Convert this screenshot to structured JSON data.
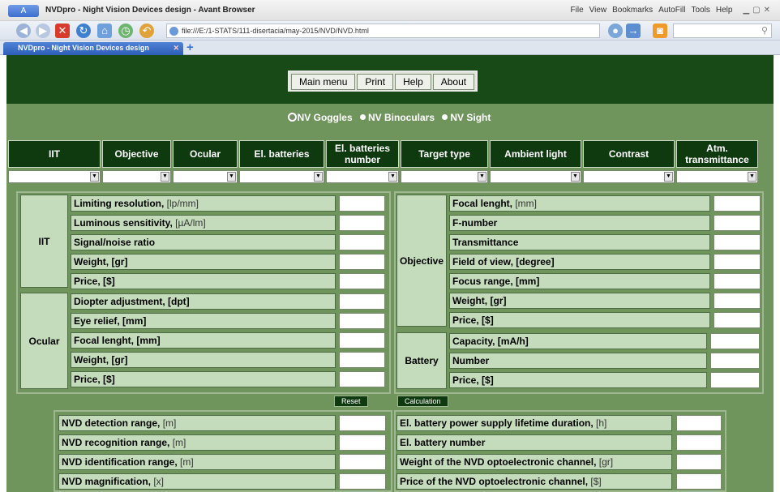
{
  "browser": {
    "logo": "A",
    "window_title": "NVDpro - Night Vision Devices design - Avant Browser",
    "menu": [
      "File",
      "View",
      "Bookmarks",
      "AutoFill",
      "Tools",
      "Help"
    ],
    "address": "file:///E:/1-STATS/111-disertacia/may-2015/NVD/NVD.html",
    "tab_title": "NVDpro - Night Vision Devices design"
  },
  "topmenu": [
    "Main menu",
    "Print",
    "Help",
    "About"
  ],
  "device_types": [
    {
      "label": "NV Goggles",
      "selected": true
    },
    {
      "label": "NV Binoculars",
      "selected": false
    },
    {
      "label": "NV Sight",
      "selected": false
    }
  ],
  "columns": [
    "IIT",
    "Objective",
    "Ocular",
    "El. batteries",
    "El. batteries number",
    "Target type",
    "Ambient light",
    "Contrast",
    "Atm. transmittance"
  ],
  "iit": {
    "title": "IIT",
    "rows": [
      {
        "label": "Limiting resolution, ",
        "unit": "[lp/mm]"
      },
      {
        "label": "Luminous sensitivity, ",
        "unit": "[µA/lm]"
      },
      {
        "label": "Signal/noise ratio",
        "unit": ""
      },
      {
        "label": "Weight, [gr]",
        "unit": ""
      },
      {
        "label": "Price, [$]",
        "unit": ""
      }
    ]
  },
  "ocular": {
    "title": "Ocular",
    "rows": [
      {
        "label": "Diopter adjustment, [dpt]",
        "unit": ""
      },
      {
        "label": "Eye relief, [mm]",
        "unit": ""
      },
      {
        "label": "Focal lenght, [mm]",
        "unit": ""
      },
      {
        "label": "Weight, [gr]",
        "unit": ""
      },
      {
        "label": "Price, [$]",
        "unit": ""
      }
    ]
  },
  "objective": {
    "title": "Objective",
    "rows": [
      {
        "label": "Focal lenght, ",
        "unit": "[mm]"
      },
      {
        "label": "F-number",
        "unit": ""
      },
      {
        "label": "Transmittance",
        "unit": ""
      },
      {
        "label": "Field of view, [degree]",
        "unit": ""
      },
      {
        "label": "Focus range, [mm]",
        "unit": ""
      },
      {
        "label": "Weight, [gr]",
        "unit": ""
      },
      {
        "label": "Price, [$]",
        "unit": ""
      }
    ]
  },
  "battery": {
    "title": "Battery",
    "rows": [
      {
        "label": "Capacity, [mA/h]",
        "unit": ""
      },
      {
        "label": "Number",
        "unit": ""
      },
      {
        "label": "Price, [$]",
        "unit": ""
      }
    ]
  },
  "actions": {
    "reset": "Reset",
    "calculation": "Calculation"
  },
  "results_left": [
    {
      "label": "NVD detection range, ",
      "unit": "[m]"
    },
    {
      "label": "NVD recognition range, ",
      "unit": "[m]"
    },
    {
      "label": "NVD identification range, ",
      "unit": "[m]"
    },
    {
      "label": "NVD magnification, ",
      "unit": "[x]"
    }
  ],
  "results_right": [
    {
      "label": "El. battery power supply lifetime duration, ",
      "unit": "[h]"
    },
    {
      "label": "El. battery number",
      "unit": ""
    },
    {
      "label": "Weight of the NVD optoelectronic channel, ",
      "unit": "[gr]"
    },
    {
      "label": "Price of the NVD optoelectronic channel, ",
      "unit": "[$]"
    }
  ],
  "colors": {
    "header": "#174a17",
    "page": "#6f955d",
    "label": "#c4dcbb"
  }
}
